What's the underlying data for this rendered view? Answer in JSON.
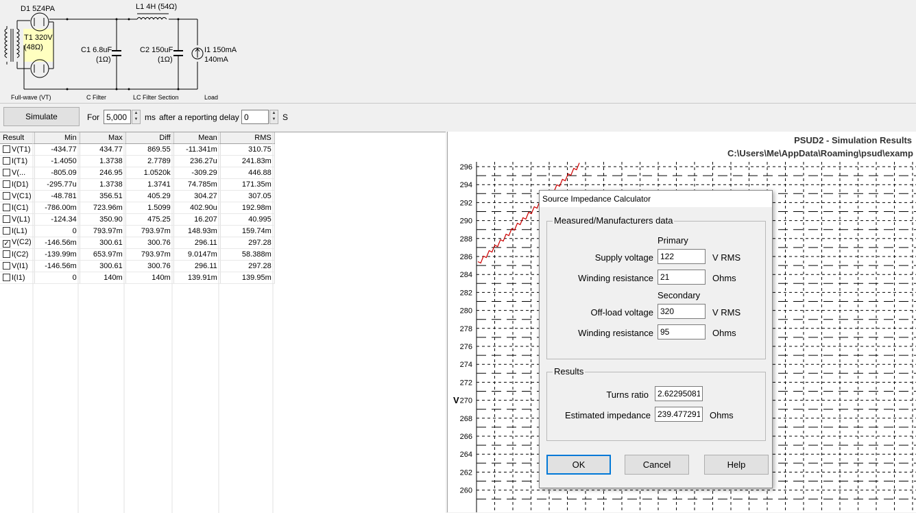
{
  "schematic": {
    "diode_label": "D1 5Z4PA",
    "transformer_label": "T1 320V",
    "transformer_res": "(48Ω)",
    "inductor_label": "L1 4H (54Ω)",
    "c1_label": "C1 6.8uF",
    "c1_res": "(1Ω)",
    "c2_label": "C2 150uF",
    "c2_res": "(1Ω)",
    "load_label": "I1 150mA",
    "load_value": "140mA",
    "sections": [
      "Full-wave (VT)",
      "C Filter",
      "LC Filter Section",
      "Load"
    ]
  },
  "toolbar": {
    "simulate_label": "Simulate",
    "for_label": "For",
    "duration_value": "5,000",
    "ms_label": "ms",
    "delay_label": "after a reporting delay of",
    "delay_value": "0",
    "s_label": "S"
  },
  "results": {
    "columns": [
      "Result",
      "Min",
      "Max",
      "Diff",
      "Mean",
      "RMS"
    ],
    "rows": [
      {
        "name": "V(T1)",
        "checked": false,
        "min": "-434.77",
        "max": "434.77",
        "diff": "869.55",
        "mean": "-11.341m",
        "rms": "310.75"
      },
      {
        "name": "I(T1)",
        "checked": false,
        "min": "-1.4050",
        "max": "1.3738",
        "diff": "2.7789",
        "mean": "236.27u",
        "rms": "241.83m"
      },
      {
        "name": "V(...",
        "checked": false,
        "min": "-805.09",
        "max": "246.95",
        "diff": "1.0520k",
        "mean": "-309.29",
        "rms": "446.88"
      },
      {
        "name": "I(D1)",
        "checked": false,
        "min": "-295.77u",
        "max": "1.3738",
        "diff": "1.3741",
        "mean": "74.785m",
        "rms": "171.35m"
      },
      {
        "name": "V(C1)",
        "checked": false,
        "min": "-48.781",
        "max": "356.51",
        "diff": "405.29",
        "mean": "304.27",
        "rms": "307.05"
      },
      {
        "name": "I(C1)",
        "checked": false,
        "min": "-786.00m",
        "max": "723.96m",
        "diff": "1.5099",
        "mean": "402.90u",
        "rms": "192.98m"
      },
      {
        "name": "V(L1)",
        "checked": false,
        "min": "-124.34",
        "max": "350.90",
        "diff": "475.25",
        "mean": "16.207",
        "rms": "40.995"
      },
      {
        "name": "I(L1)",
        "checked": false,
        "min": "0",
        "max": "793.97m",
        "diff": "793.97m",
        "mean": "148.93m",
        "rms": "159.74m"
      },
      {
        "name": "V(C2)",
        "checked": true,
        "min": "-146.56m",
        "max": "300.61",
        "diff": "300.76",
        "mean": "296.11",
        "rms": "297.28"
      },
      {
        "name": "I(C2)",
        "checked": false,
        "min": "-139.99m",
        "max": "653.97m",
        "diff": "793.97m",
        "mean": "9.0147m",
        "rms": "58.388m"
      },
      {
        "name": "V(I1)",
        "checked": false,
        "min": "-146.56m",
        "max": "300.61",
        "diff": "300.76",
        "mean": "296.11",
        "rms": "297.28"
      },
      {
        "name": "I(I1)",
        "checked": false,
        "min": "0",
        "max": "140m",
        "diff": "140m",
        "mean": "139.91m",
        "rms": "139.95m"
      }
    ]
  },
  "graph": {
    "title": "PSUD2 - Simulation Results",
    "path": "C:\\Users\\Me\\AppData\\Roaming\\psud\\examp",
    "y_label": "V",
    "y_ticks": [
      "296",
      "294",
      "292",
      "290",
      "288",
      "286",
      "284",
      "282",
      "280",
      "278",
      "276",
      "274",
      "272",
      "270",
      "268",
      "266",
      "264",
      "262",
      "260"
    ],
    "trace_color": "#cc0000"
  },
  "dialog": {
    "title": "Source Impedance Calculator",
    "group1_label": "Measured/Manufacturers data",
    "primary_label": "Primary",
    "supply_voltage_label": "Supply voltage",
    "supply_voltage_value": "122",
    "supply_voltage_unit": "V RMS",
    "primary_winding_label": "Winding resistance",
    "primary_winding_value": "21",
    "primary_winding_unit": "Ohms",
    "secondary_label": "Secondary",
    "offload_label": "Off-load voltage",
    "offload_value": "320",
    "offload_unit": "V RMS",
    "secondary_winding_label": "Winding resistance",
    "secondary_winding_value": "95",
    "secondary_winding_unit": "Ohms",
    "group2_label": "Results",
    "turns_ratio_label": "Turns ratio",
    "turns_ratio_value": "2.62295081",
    "impedance_label": "Estimated impedance",
    "impedance_value": "239.477291",
    "impedance_unit": "Ohms",
    "ok_label": "OK",
    "cancel_label": "Cancel",
    "help_label": "Help"
  }
}
